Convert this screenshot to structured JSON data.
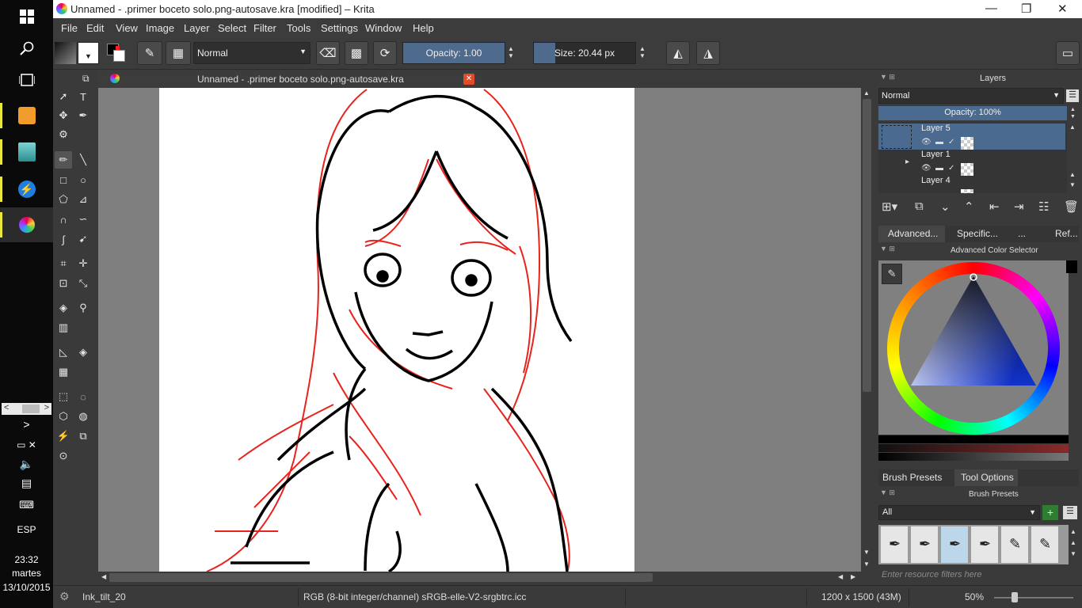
{
  "window": {
    "title": "Unnamed - .primer boceto solo.png-autosave.kra [modified] – Krita"
  },
  "menu": [
    "File",
    "Edit",
    "View",
    "Image",
    "Layer",
    "Select",
    "Filter",
    "Tools",
    "Settings",
    "Window",
    "Help"
  ],
  "toolbar": {
    "blend_mode": "Normal",
    "opacity_label": "Opacity:  1.00",
    "opacity": 1.0,
    "size_label": "Size:  20.44 px"
  },
  "document": {
    "tab_title": "Unnamed - .primer boceto solo.png-autosave.kra"
  },
  "layers_docker": {
    "title": "Layers",
    "blend_mode": "Normal",
    "opacity_label": "Opacity:  100%",
    "layers": [
      {
        "name": "Layer 5",
        "selected": true
      },
      {
        "name": "Layer 1",
        "selected": false
      },
      {
        "name": "Layer 4",
        "selected": false
      }
    ]
  },
  "color_tabs": [
    "Advanced...",
    "Specific...",
    "...",
    "Ref..."
  ],
  "color_selector": {
    "title": "Advanced Color Selector"
  },
  "bottom_tabs": [
    "Brush Presets",
    "Tool Options"
  ],
  "brush_presets": {
    "title": "Brush Presets",
    "filter": "All",
    "search_placeholder": "Enter resource filters here"
  },
  "statusbar": {
    "brush": "Ink_tilt_20",
    "color_model": "RGB (8-bit integer/channel)  sRGB-elle-V2-srgbtrc.icc",
    "dimensions": "1200 x 1500 (43M)",
    "zoom": "50%"
  },
  "taskbar": {
    "lang": "ESP",
    "time": "23:32",
    "day": "martes",
    "date": "13/10/2015"
  },
  "colors": {
    "accent": "#4e6a8d",
    "selection": "#4b6a8f"
  }
}
